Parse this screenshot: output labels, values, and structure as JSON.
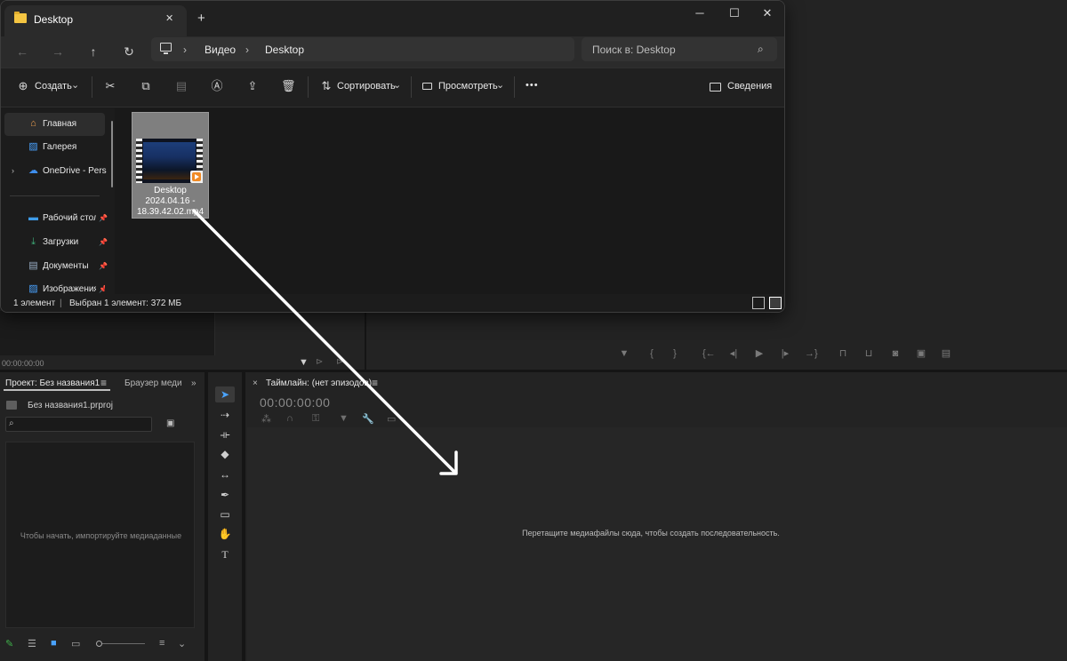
{
  "explorer": {
    "tab_title": "Desktop",
    "new_tab_label": "+",
    "close_tab_label": "✕",
    "window_buttons": {
      "minimize": "─",
      "maximize": "☐",
      "close": "✕"
    },
    "nav": {
      "back": "←",
      "forward": "→",
      "up": "↑",
      "refresh": "↻"
    },
    "breadcrumb": [
      "Видео",
      "Desktop"
    ],
    "breadcrumb_sep": "›",
    "search_placeholder": "Поиск в: Desktop",
    "commands": {
      "new": "Создать",
      "sort": "Сортировать",
      "view": "Просмотреть",
      "more": "•••",
      "details": "Сведения"
    },
    "sidebar": [
      {
        "label": "Главная",
        "icon": "home-icon"
      },
      {
        "label": "Галерея",
        "icon": "gallery-icon"
      },
      {
        "label": "OneDrive - Personal",
        "icon": "onedrive-icon"
      },
      {
        "label": "Рабочий стол",
        "icon": "desktop-icon"
      },
      {
        "label": "Загрузки",
        "icon": "download-icon"
      },
      {
        "label": "Документы",
        "icon": "documents-icon"
      },
      {
        "label": "Изображения",
        "icon": "pictures-icon"
      }
    ],
    "file": {
      "name_line1": "Desktop",
      "name_line2": "2024.04.16 -",
      "name_line3": "18.39.42.02.mp4"
    },
    "status": {
      "count": "1 элемент",
      "sep": "|",
      "selected": "Выбран 1 элемент: 372 МБ"
    }
  },
  "premiere": {
    "source_timecode": "00:00:00:00",
    "project_tab": "Проект: Без названия1",
    "media_browser_tab": "Браузер меди",
    "project_file": "Без названия1.prproj",
    "project_empty_hint": "Чтобы начать, импортируйте медиаданные",
    "timeline_tab": "Таймлайн: (нет эпизодов)",
    "timeline_timecode": "00:00:00:00",
    "timeline_hint": "Перетащите медиафайлы сюда, чтобы создать последовательность.",
    "menu_icon": "≡",
    "tab_close": "×"
  },
  "colors": {
    "accent_blue": "#4aa3ff",
    "folder_yellow": "#f4c542",
    "arrow": "#ffffff"
  }
}
